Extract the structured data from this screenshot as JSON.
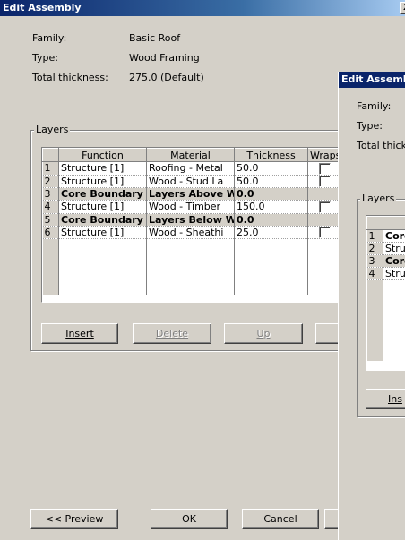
{
  "dialog1": {
    "title": "Edit Assembly",
    "close_glyph": "X",
    "family_label": "Family:",
    "family_value": "Basic Roof",
    "type_label": "Type:",
    "type_value": "Wood Framing",
    "thickness_label": "Total thickness:",
    "thickness_value": "275.0 (Default)",
    "layers_label": "Layers",
    "columns": [
      "Function",
      "Material",
      "Thickness",
      "Wraps"
    ],
    "rows": [
      {
        "num": "1",
        "function": "Structure [1]",
        "material": "Roofing - Metal",
        "thickness": "50.0",
        "wraps": false,
        "core": false
      },
      {
        "num": "2",
        "function": "Structure [1]",
        "material": "Wood - Stud La",
        "thickness": "50.0",
        "wraps": false,
        "core": false
      },
      {
        "num": "3",
        "function": "Core Boundary",
        "material": "Layers Above W",
        "thickness": "0.0",
        "core": true
      },
      {
        "num": "4",
        "function": "Structure [1]",
        "material": "Wood - Timber",
        "thickness": "150.0",
        "wraps": false,
        "core": false
      },
      {
        "num": "5",
        "function": "Core Boundary",
        "material": "Layers Below W",
        "thickness": "0.0",
        "core": true
      },
      {
        "num": "6",
        "function": "Structure [1]",
        "material": "Wood - Sheathi",
        "thickness": "25.0",
        "wraps": false,
        "core": false
      }
    ],
    "buttons": {
      "insert": "Insert",
      "delete": "Delete",
      "up": "Up",
      "preview": "<< Preview",
      "ok": "OK",
      "cancel": "Cancel"
    }
  },
  "dialog2": {
    "title": "Edit Assemb",
    "family_label": "Family:",
    "type_label": "Type:",
    "thickness_label": "Total thickn",
    "layers_label": "Layers",
    "rows": [
      {
        "num": "1",
        "function": "Core",
        "core": true
      },
      {
        "num": "2",
        "function": "Struc",
        "core": false
      },
      {
        "num": "3",
        "function": "Core",
        "core": true
      },
      {
        "num": "4",
        "function": "Struc",
        "core": false
      }
    ],
    "insert_button": "Ins"
  }
}
